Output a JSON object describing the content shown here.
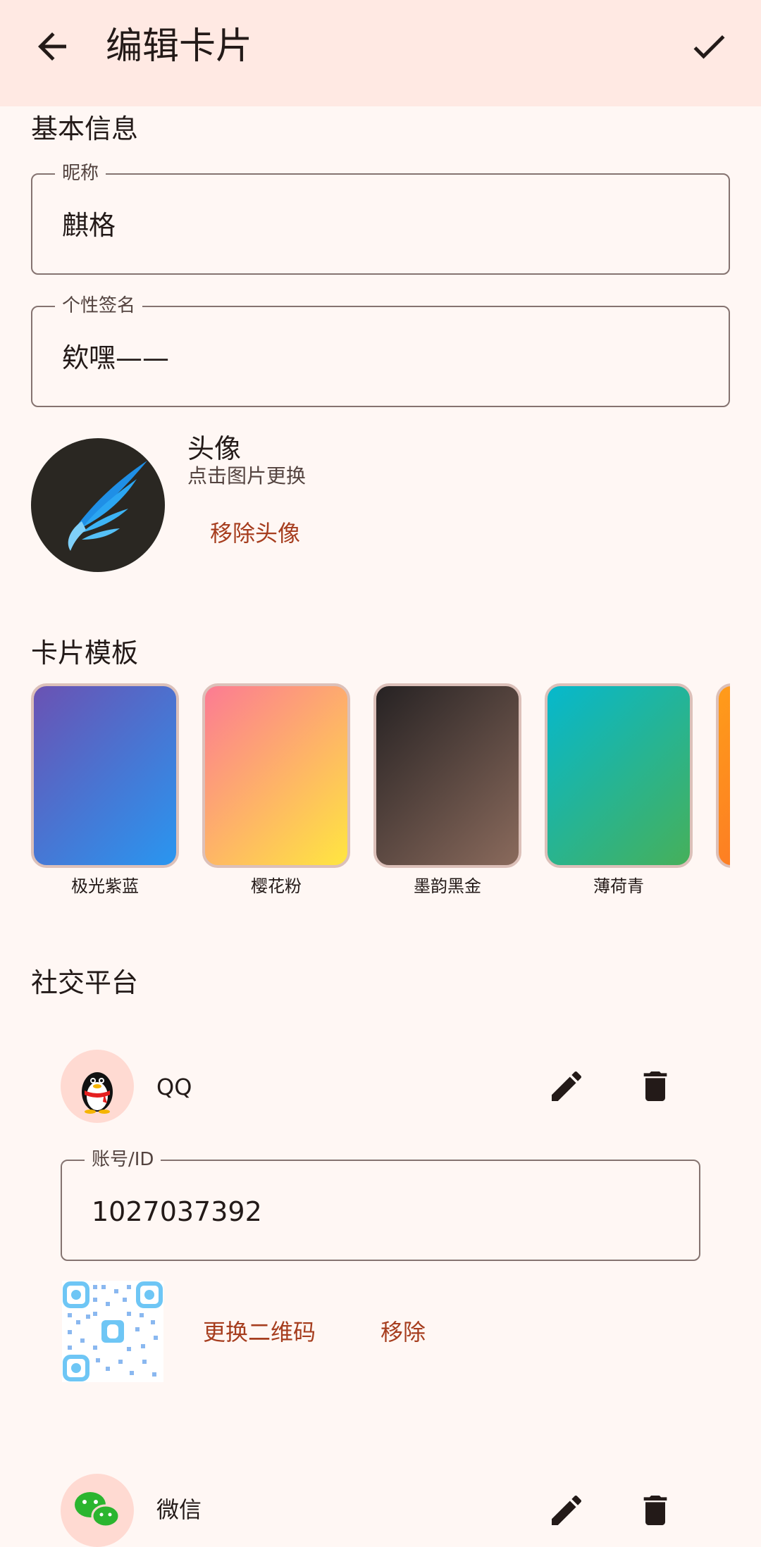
{
  "app": {
    "title": "编辑卡片"
  },
  "basic": {
    "section_title": "基本信息",
    "nickname_label": "昵称",
    "nickname_value": "麒格",
    "signature_label": "个性签名",
    "signature_value": "欸嘿——"
  },
  "avatar": {
    "title": "头像",
    "hint": "点击图片更换",
    "remove_label": "移除头像"
  },
  "templates": {
    "section_title": "卡片模板",
    "items": [
      {
        "name": "极光紫蓝",
        "colors": [
          "#6a52b3",
          "#2996f0"
        ]
      },
      {
        "name": "樱花粉",
        "colors": [
          "#fc7b93",
          "#ffe640"
        ]
      },
      {
        "name": "墨韵黑金",
        "colors": [
          "#262223",
          "#8a6a5c"
        ]
      },
      {
        "name": "薄荷青",
        "colors": [
          "#06b8cd",
          "#46b05a"
        ]
      },
      {
        "name": "",
        "colors": [
          "#ff9c1a",
          "#fb6a2a"
        ]
      }
    ]
  },
  "social": {
    "section_title": "社交平台",
    "platforms": [
      {
        "name": "QQ",
        "icon": "qq-penguin-icon",
        "account_label": "账号/ID",
        "account_value": "1027037392",
        "change_qr_label": "更换二维码",
        "remove_label": "移除"
      },
      {
        "name": "微信",
        "icon": "wechat-icon"
      }
    ]
  },
  "colors": {
    "appbar_bg": "#ffe9e3",
    "page_bg": "#fff7f4",
    "accent_text": "#a63d1e"
  }
}
